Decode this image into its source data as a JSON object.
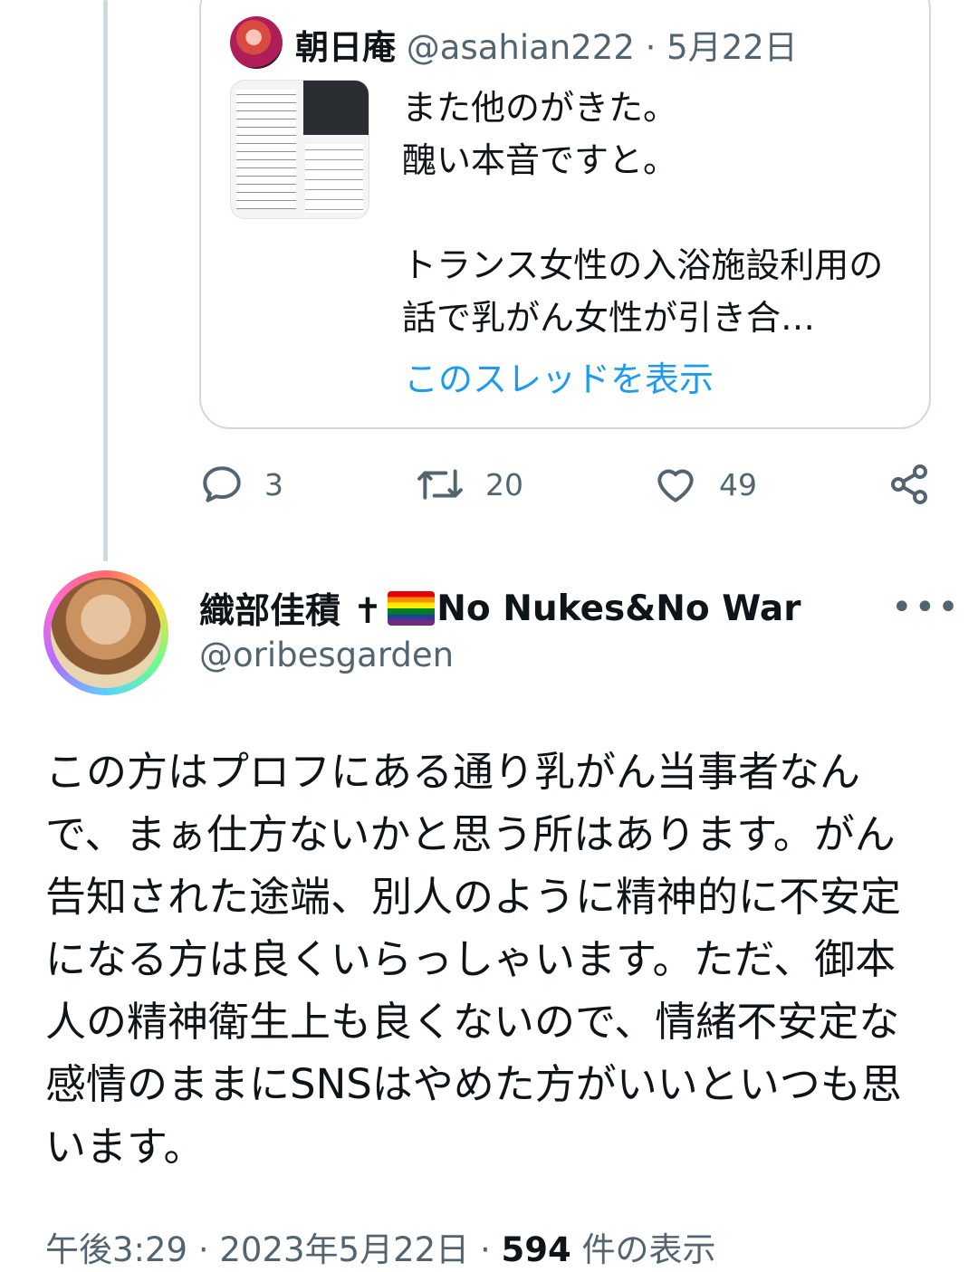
{
  "quoted": {
    "name": "朝日庵",
    "handle": "@asahian222",
    "separator": "·",
    "date": "5月22日",
    "text": "また他のがきた。\n醜い本音ですと。\n\nトランス女性の入浴施設利用の話で乳がん女性が引き合…",
    "show_thread": "このスレッドを表示"
  },
  "actions": {
    "replies": "3",
    "retweets": "20",
    "likes": "49"
  },
  "tweet": {
    "name": "織部佳積 ✝",
    "name_suffix": "No Nukes&No War",
    "handle": "@oribesgarden",
    "more": "•••",
    "text": "この方はプロフにある通り乳がん当事者なんで、まぁ仕方ないかと思う所はあります。がん告知された途端、別人のように精神的に不安定になる方は良くいらっしゃいます。ただ、御本人の精神衛生上も良くないので、情緒不安定な感情のままにSNSはやめた方がいいといつも思います。",
    "time": "午後3:29",
    "date": "2023年5月22日",
    "views_count": "594",
    "views_label": "件の表示",
    "sep": "·"
  },
  "colors": {
    "accent": "#1d9bf0",
    "muted": "#536471",
    "border": "#cfd9de"
  },
  "icons": [
    "reply-icon",
    "retweet-icon",
    "like-icon",
    "share-icon",
    "more-icon",
    "rainbow-flag-icon"
  ]
}
